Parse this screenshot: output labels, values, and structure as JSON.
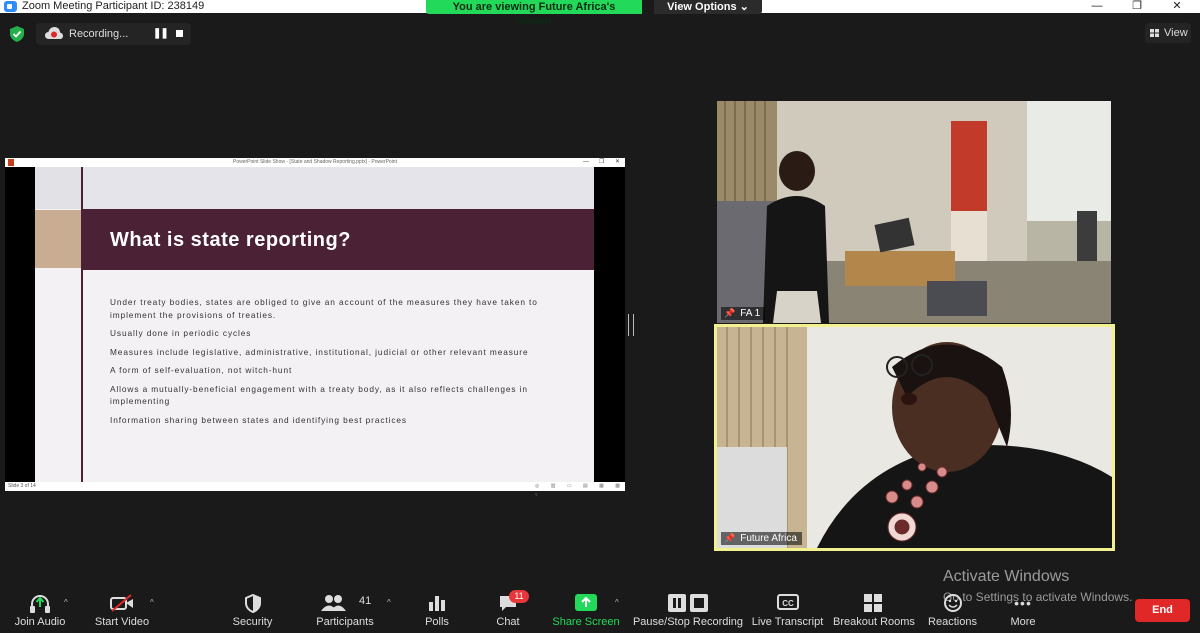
{
  "window": {
    "title": "Zoom Meeting Participant ID: 238149",
    "minimize": "—",
    "maximize": "❐",
    "close": "✕"
  },
  "banner": {
    "viewing_text": "You are viewing Future Africa's screen",
    "view_options_label": "View Options ⌄"
  },
  "recording": {
    "label": "Recording..."
  },
  "view_button": {
    "label": "View"
  },
  "shared_screen": {
    "ppt_title": "PowerPoint Slide Show - [State and Shadow Reporting.pptx] - PowerPoint",
    "slide_number": "Slide 3 of 14",
    "slide_title": "What is state reporting?",
    "bullets": [
      "Under treaty bodies, states are obliged to give an account of the measures they have taken to implement the provisions of treaties.",
      "Usually done in periodic cycles",
      "Measures include legislative, administrative, institutional, judicial or other relevant measure",
      "A form of self-evaluation, not witch-hunt",
      "Allows a mutually-beneficial engagement with a treaty body, as it also reflects challenges in implementing",
      "Information sharing between states and identifying best practices"
    ]
  },
  "participants_video": [
    {
      "name": "FA 1"
    },
    {
      "name": "Future Africa"
    }
  ],
  "toolbar": {
    "join_audio": "Join Audio",
    "start_video": "Start Video",
    "security": "Security",
    "participants": "Participants",
    "participants_count": "41",
    "polls": "Polls",
    "chat": "Chat",
    "chat_badge": "11",
    "share_screen": "Share Screen",
    "pause_stop_recording": "Pause/Stop Recording",
    "live_transcript": "Live Transcript",
    "breakout_rooms": "Breakout Rooms",
    "reactions": "Reactions",
    "more": "More",
    "end": "End"
  },
  "watermark": {
    "line1": "Activate Windows",
    "line2": "Go to Settings to activate Windows."
  },
  "colors": {
    "share_green": "#23d959",
    "end_red": "#e02828",
    "slide_maroon": "#4b2136",
    "active_speaker_border": "#f1f28f"
  }
}
